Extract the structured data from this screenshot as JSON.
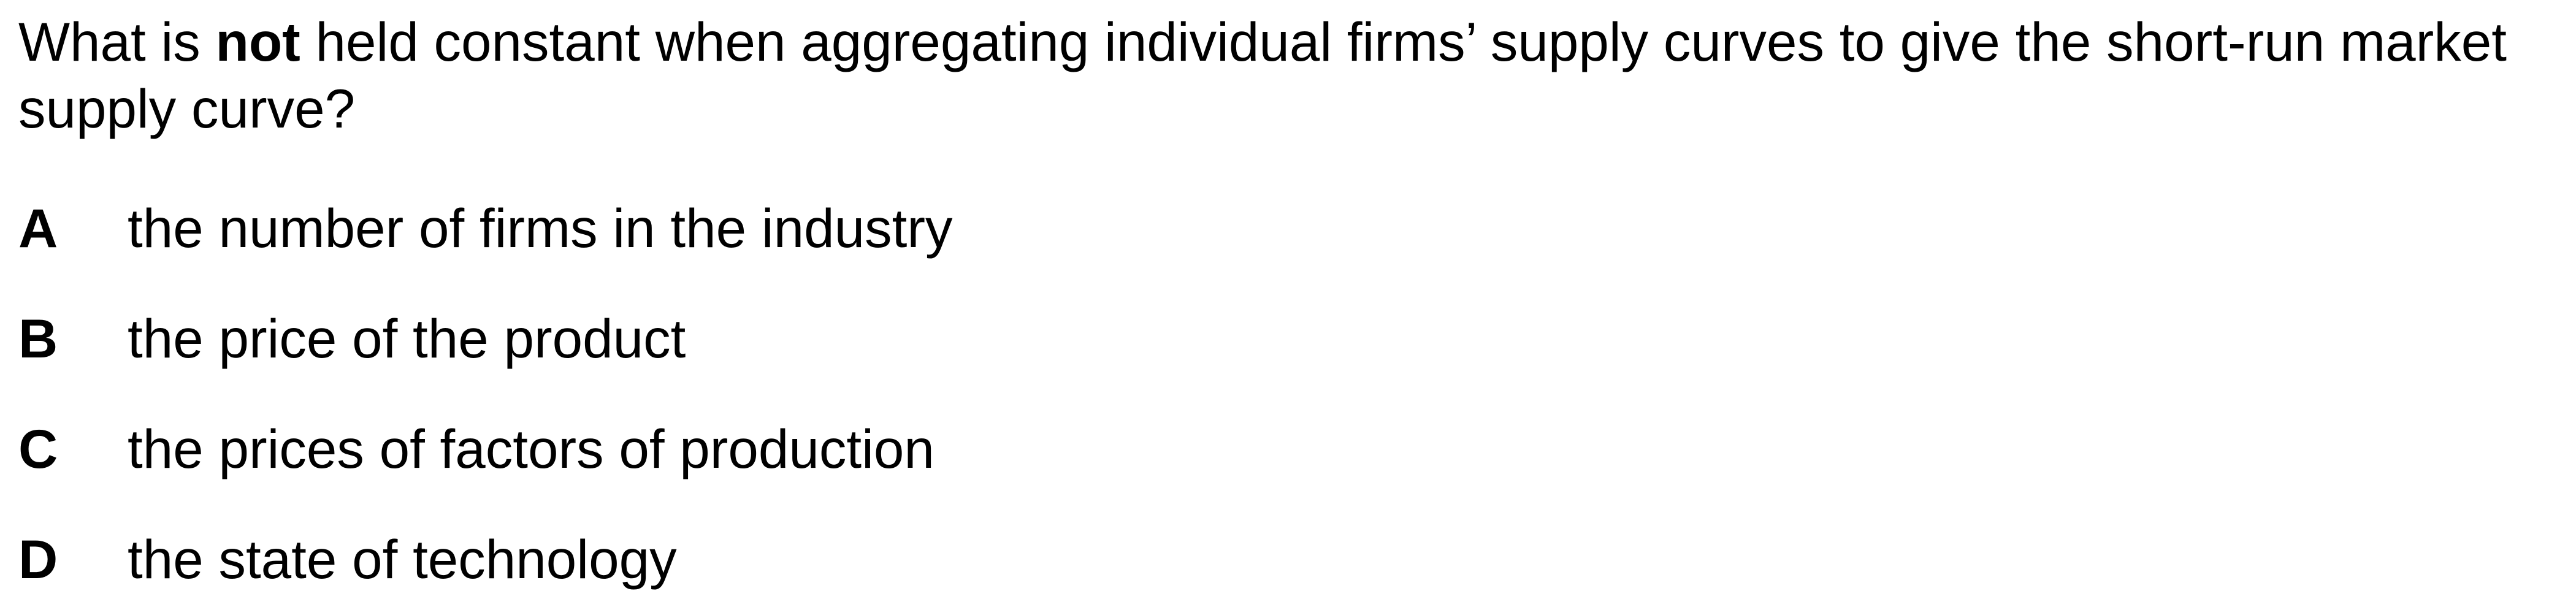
{
  "question": {
    "prefix": "What is ",
    "emphasis": "not",
    "suffix": " held constant when aggregating individual firms’ supply curves to give the short-run market supply curve?"
  },
  "options": [
    {
      "letter": "A",
      "text": "the number of firms in the industry"
    },
    {
      "letter": "B",
      "text": "the price of the product"
    },
    {
      "letter": "C",
      "text": "the prices of factors of production"
    },
    {
      "letter": "D",
      "text": "the state of technology"
    }
  ]
}
